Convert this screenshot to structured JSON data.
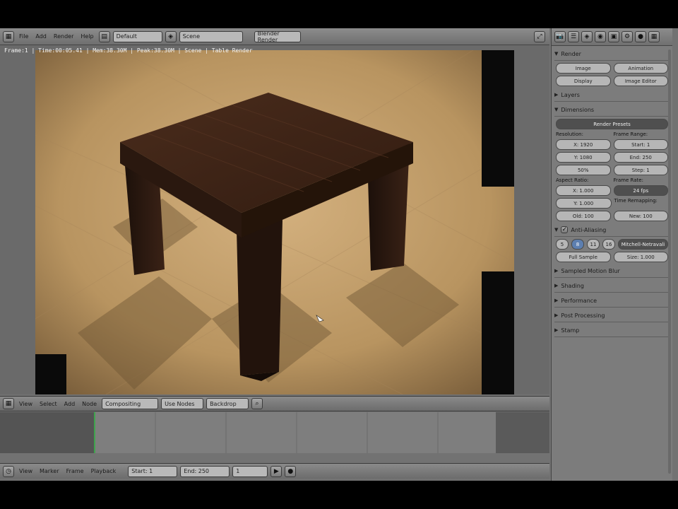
{
  "header": {
    "menu": [
      "File",
      "Add",
      "Render",
      "Help"
    ],
    "scene_field": "Scene",
    "render_field": "Blender Render",
    "layout_field": "Default"
  },
  "render": {
    "stats": "Frame:1 | Time:00:05.41 | Mem:38.30M | Peak:38.30M | Scene | Table Render"
  },
  "node_header": {
    "items": [
      "View",
      "Select",
      "Add",
      "Node",
      "Compositing",
      "Use Nodes",
      "Backdrop"
    ]
  },
  "bottom_bar": {
    "items": [
      "View",
      "Marker",
      "Frame",
      "Playback",
      "Start: 1",
      "End: 250",
      "1"
    ]
  },
  "properties": {
    "tabs": [
      "Render",
      "Layers",
      "Scene",
      "World",
      "Object",
      "Modifiers",
      "Material",
      "Texture"
    ],
    "sections": [
      {
        "label": "Render",
        "open": true
      },
      {
        "label": "Layers",
        "open": false
      },
      {
        "label": "Dimensions",
        "open": true
      }
    ],
    "render_buttons": [
      "Image",
      "Animation",
      "Display"
    ],
    "display_value": "Image Editor",
    "preset": "Render Presets",
    "resolution_label": "Resolution:",
    "res_x": "X: 1920",
    "res_y": "Y: 1080",
    "res_pct": "50%",
    "frame_range_label": "Frame Range:",
    "start": "Start: 1",
    "end": "End: 250",
    "step": "Step: 1",
    "aspect_label": "Aspect Ratio:",
    "aspect_x": "X: 1.000",
    "aspect_y": "Y: 1.000",
    "fps_label": "Frame Rate:",
    "fps": "24 fps",
    "time_remap": "Time Remapping:",
    "old": "Old: 100",
    "new": "New: 100",
    "aa_label": "Anti-Aliasing",
    "aa_samples": [
      "5",
      "8",
      "11",
      "16"
    ],
    "aa_filter": "Mitchell-Netravali",
    "full_sample": "Full Sample",
    "size": "Size: 1.000",
    "more_sections": [
      "Sampled Motion Blur",
      "Shading",
      "Performance",
      "Post Processing",
      "Stamp"
    ]
  },
  "colors": {
    "panel": "#7c7c7c",
    "header": "#8a8a8a",
    "floor": "#c9a472",
    "wood": "#3a2216",
    "accent": "#5d7fb0"
  }
}
